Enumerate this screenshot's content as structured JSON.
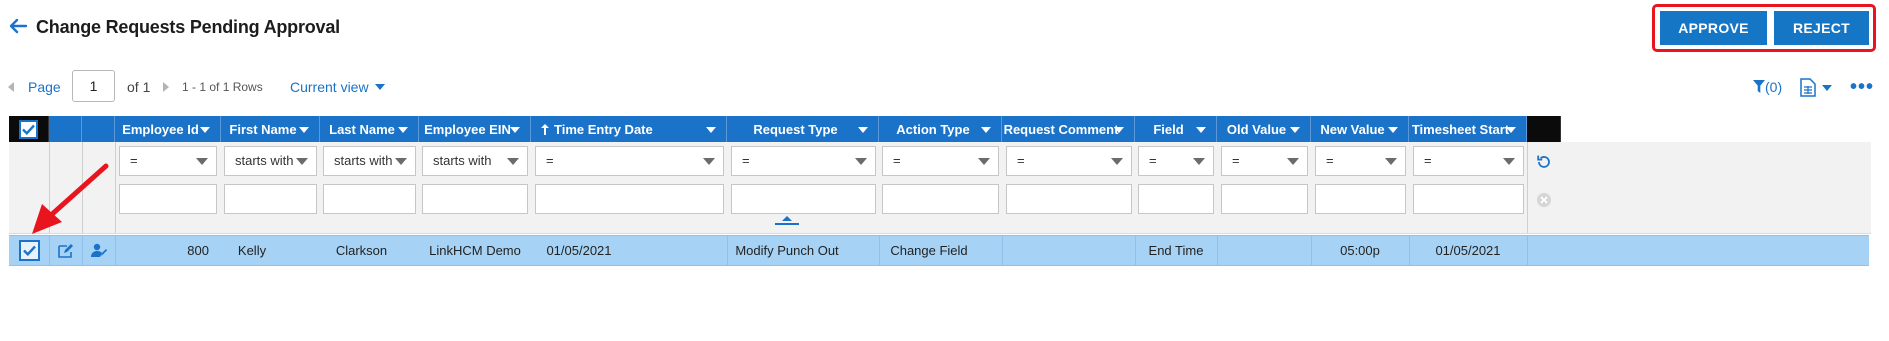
{
  "header": {
    "title": "Change Requests Pending Approval",
    "approve_label": "APPROVE",
    "reject_label": "REJECT"
  },
  "pager": {
    "page_label": "Page",
    "page_value": "1",
    "of_label": "of 1",
    "rows_label": "1 - 1 of 1 Rows",
    "view_label": "Current view",
    "filter_count": "(0)"
  },
  "columns": [
    {
      "label": "Employee Id"
    },
    {
      "label": "First Name"
    },
    {
      "label": "Last Name"
    },
    {
      "label": "Employee EIN"
    },
    {
      "label": "Time Entry Date"
    },
    {
      "label": "Request Type"
    },
    {
      "label": "Action Type"
    },
    {
      "label": "Request Comment"
    },
    {
      "label": "Field"
    },
    {
      "label": "Old Value"
    },
    {
      "label": "New Value"
    },
    {
      "label": "Timesheet Start"
    }
  ],
  "filters": [
    "=",
    "starts with",
    "starts with",
    "starts with",
    "=",
    "=",
    "=",
    "=",
    "=",
    "=",
    "=",
    "="
  ],
  "rows": [
    {
      "employee_id": "800",
      "first_name": "Kelly",
      "last_name": "Clarkson",
      "employee_ein": "LinkHCM Demo",
      "time_entry_date": "01/05/2021",
      "request_type": "Modify Punch Out",
      "action_type": "Change Field",
      "request_comment": "",
      "field": "End Time",
      "old_value": "",
      "new_value": "05:00p",
      "timesheet_start": "01/05/2021"
    }
  ],
  "colors": {
    "accent": "#1a73c8",
    "header_bg": "#1a73c8",
    "selected_row": "#a6d3f5",
    "highlight": "#e8151f"
  }
}
